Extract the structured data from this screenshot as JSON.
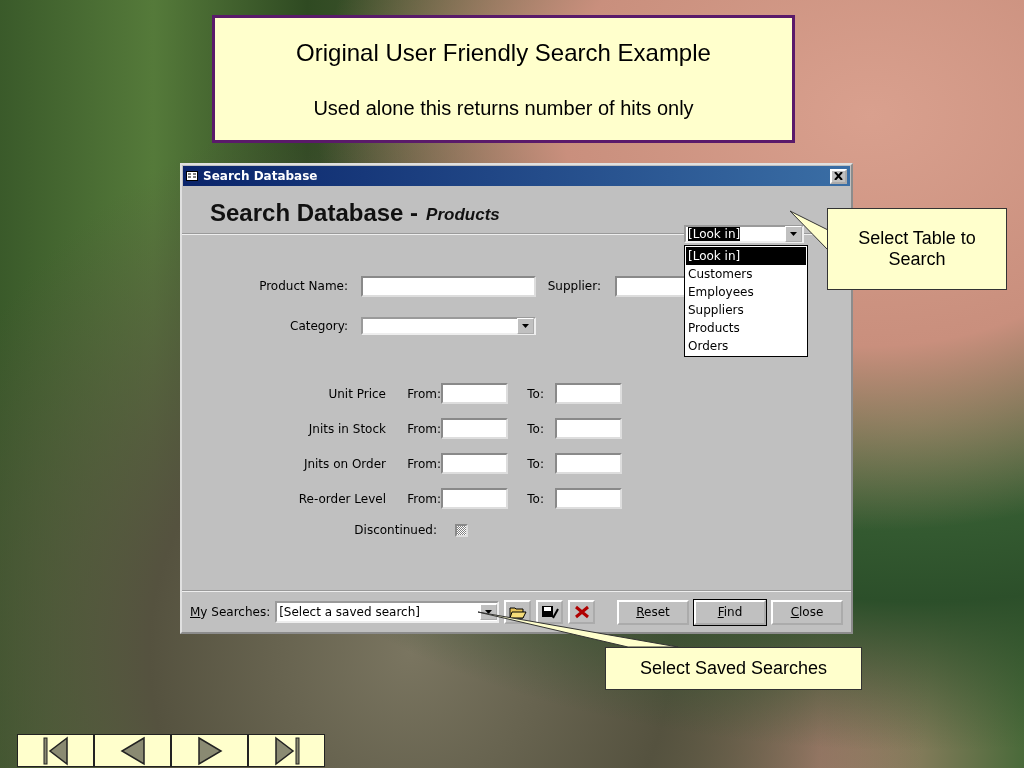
{
  "title_box": {
    "heading": "Original User Friendly Search Example",
    "subheading": "Used alone this returns number of hits only"
  },
  "dialog": {
    "title": "Search Database",
    "heading": "Search Database -",
    "table_name": "Products",
    "look_in": {
      "value": "[Look in]",
      "expanded": true,
      "options": [
        {
          "label": "[Look in]",
          "selected": true
        },
        {
          "label": "Customers",
          "selected": false
        },
        {
          "label": "Employees",
          "selected": false
        },
        {
          "label": "Suppliers",
          "selected": false
        },
        {
          "label": "Products",
          "selected": false
        },
        {
          "label": "Orders",
          "selected": false
        }
      ]
    },
    "product_name": {
      "label": "Product Name:"
    },
    "supplier": {
      "label": "Supplier:"
    },
    "category": {
      "label": "Category:"
    },
    "ranges": [
      {
        "label": "Unit Price",
        "from": "From:",
        "to": "To:"
      },
      {
        "label": "Jnits in Stock",
        "from": "From:",
        "to": "To:"
      },
      {
        "label": "Jnits on Order",
        "from": "From:",
        "to": "To:"
      },
      {
        "label": "Re-order Level",
        "from": "From:",
        "to": "To:"
      }
    ],
    "discontinued": {
      "label": "Discontinued:",
      "indeterminate": true
    },
    "my_searches": {
      "label": "My Searches:",
      "value": "[Select a saved search]"
    },
    "buttons": [
      {
        "label": "Reset",
        "default": false
      },
      {
        "label": "Find",
        "default": true
      },
      {
        "label": "Close",
        "default": false
      }
    ]
  },
  "callouts": [
    {
      "text": "Select Table to Search"
    },
    {
      "text": "Select Saved Searches"
    }
  ],
  "navigation": [
    {
      "kind": "first"
    },
    {
      "kind": "previous"
    },
    {
      "kind": "next"
    },
    {
      "kind": "last"
    }
  ]
}
